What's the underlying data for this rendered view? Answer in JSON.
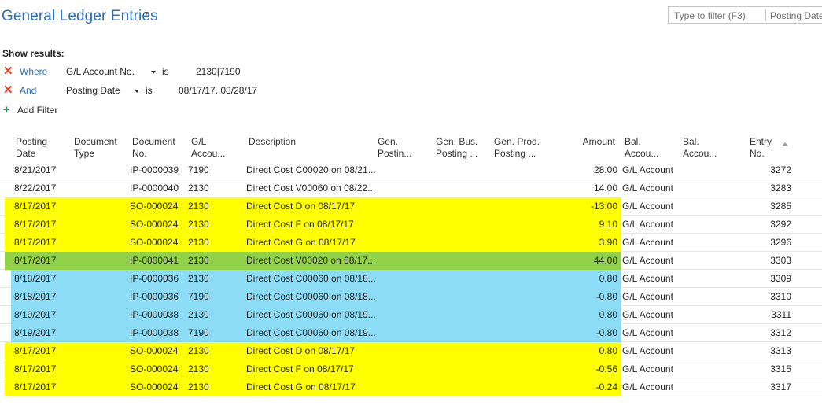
{
  "page": {
    "title": "General Ledger Entries",
    "filter_placeholder": "Type to filter (F3)",
    "filter_field": "Posting Date"
  },
  "filters": {
    "show_results_label": "Show results:",
    "items": [
      {
        "keyword": "Where",
        "field": "G/L Account No.",
        "operator": "is",
        "value": "2130|7190"
      },
      {
        "keyword": "And",
        "field": "Posting Date",
        "operator": "is",
        "value": "08/17/17..08/28/17"
      }
    ],
    "add_filter_label": "Add Filter"
  },
  "columns": {
    "posting_date": [
      "Posting",
      "Date"
    ],
    "document_type": [
      "Document",
      "Type"
    ],
    "document_no": [
      "Document",
      "No."
    ],
    "gl_account": [
      "G/L",
      "Accou..."
    ],
    "description": [
      "Description"
    ],
    "gen_posting": [
      "Gen.",
      "Postin..."
    ],
    "gen_bus": [
      "Gen. Bus.",
      "Posting ..."
    ],
    "gen_prod": [
      "Gen. Prod.",
      "Posting ..."
    ],
    "amount": [
      "Amount"
    ],
    "bal_acct1": [
      "Bal.",
      "Accou..."
    ],
    "bal_acct2": [
      "Bal.",
      "Accou..."
    ],
    "entry_no": [
      "Entry",
      "No."
    ]
  },
  "colors": {
    "yellow": "#ffff00",
    "green": "#92d24a",
    "blue": "#8ddcf5",
    "accent": "#2a6ebb"
  },
  "rows": [
    {
      "date": "8/21/2017",
      "doc_no": "IP-0000039",
      "account": "7190",
      "description": "Direct Cost C00020 on 08/21...",
      "amount": "28.00",
      "bal_type": "G/L Account",
      "entry": "3272",
      "hl": "none"
    },
    {
      "date": "8/22/2017",
      "doc_no": "IP-0000040",
      "account": "2130",
      "description": "Direct Cost V00060 on 08/22...",
      "amount": "14.00",
      "bal_type": "G/L Account",
      "entry": "3283",
      "hl": "none"
    },
    {
      "date": "8/17/2017",
      "doc_no": "SO-000024",
      "account": "2130",
      "description": "Direct Cost D on 08/17/17",
      "amount": "-13.00",
      "bal_type": "G/L Account",
      "entry": "3285",
      "hl": "yellow"
    },
    {
      "date": "8/17/2017",
      "doc_no": "SO-000024",
      "account": "2130",
      "description": "Direct Cost F on 08/17/17",
      "amount": "9.10",
      "bal_type": "G/L Account",
      "entry": "3292",
      "hl": "yellow"
    },
    {
      "date": "8/17/2017",
      "doc_no": "SO-000024",
      "account": "2130",
      "description": "Direct Cost G on 08/17/17",
      "amount": "3.90",
      "bal_type": "G/L Account",
      "entry": "3296",
      "hl": "yellow"
    },
    {
      "date": "8/17/2017",
      "doc_no": "IP-0000041",
      "account": "2130",
      "description": "Direct Cost V00020 on 08/17...",
      "amount": "44.00",
      "bal_type": "G/L Account",
      "entry": "3303",
      "hl": "green"
    },
    {
      "date": "8/18/2017",
      "doc_no": "IP-0000036",
      "account": "2130",
      "description": "Direct Cost C00060 on 08/18...",
      "amount": "0.80",
      "bal_type": "G/L Account",
      "entry": "3309",
      "hl": "blue"
    },
    {
      "date": "8/18/2017",
      "doc_no": "IP-0000036",
      "account": "7190",
      "description": "Direct Cost C00060 on 08/18...",
      "amount": "-0.80",
      "bal_type": "G/L Account",
      "entry": "3310",
      "hl": "blue"
    },
    {
      "date": "8/19/2017",
      "doc_no": "IP-0000038",
      "account": "2130",
      "description": "Direct Cost C00060 on 08/19...",
      "amount": "0.80",
      "bal_type": "G/L Account",
      "entry": "3311",
      "hl": "blue"
    },
    {
      "date": "8/19/2017",
      "doc_no": "IP-0000038",
      "account": "7190",
      "description": "Direct Cost C00060 on 08/19...",
      "amount": "-0.80",
      "bal_type": "G/L Account",
      "entry": "3312",
      "hl": "blue"
    },
    {
      "date": "8/17/2017",
      "doc_no": "SO-000024",
      "account": "2130",
      "description": "Direct Cost D on 08/17/17",
      "amount": "0.80",
      "bal_type": "G/L Account",
      "entry": "3313",
      "hl": "yellow"
    },
    {
      "date": "8/17/2017",
      "doc_no": "SO-000024",
      "account": "2130",
      "description": "Direct Cost F on 08/17/17",
      "amount": "-0.56",
      "bal_type": "G/L Account",
      "entry": "3315",
      "hl": "yellow"
    },
    {
      "date": "8/17/2017",
      "doc_no": "SO-000024",
      "account": "2130",
      "description": "Direct Cost G on 08/17/17",
      "amount": "-0.24",
      "bal_type": "G/L Account",
      "entry": "3317",
      "hl": "yellow"
    }
  ]
}
